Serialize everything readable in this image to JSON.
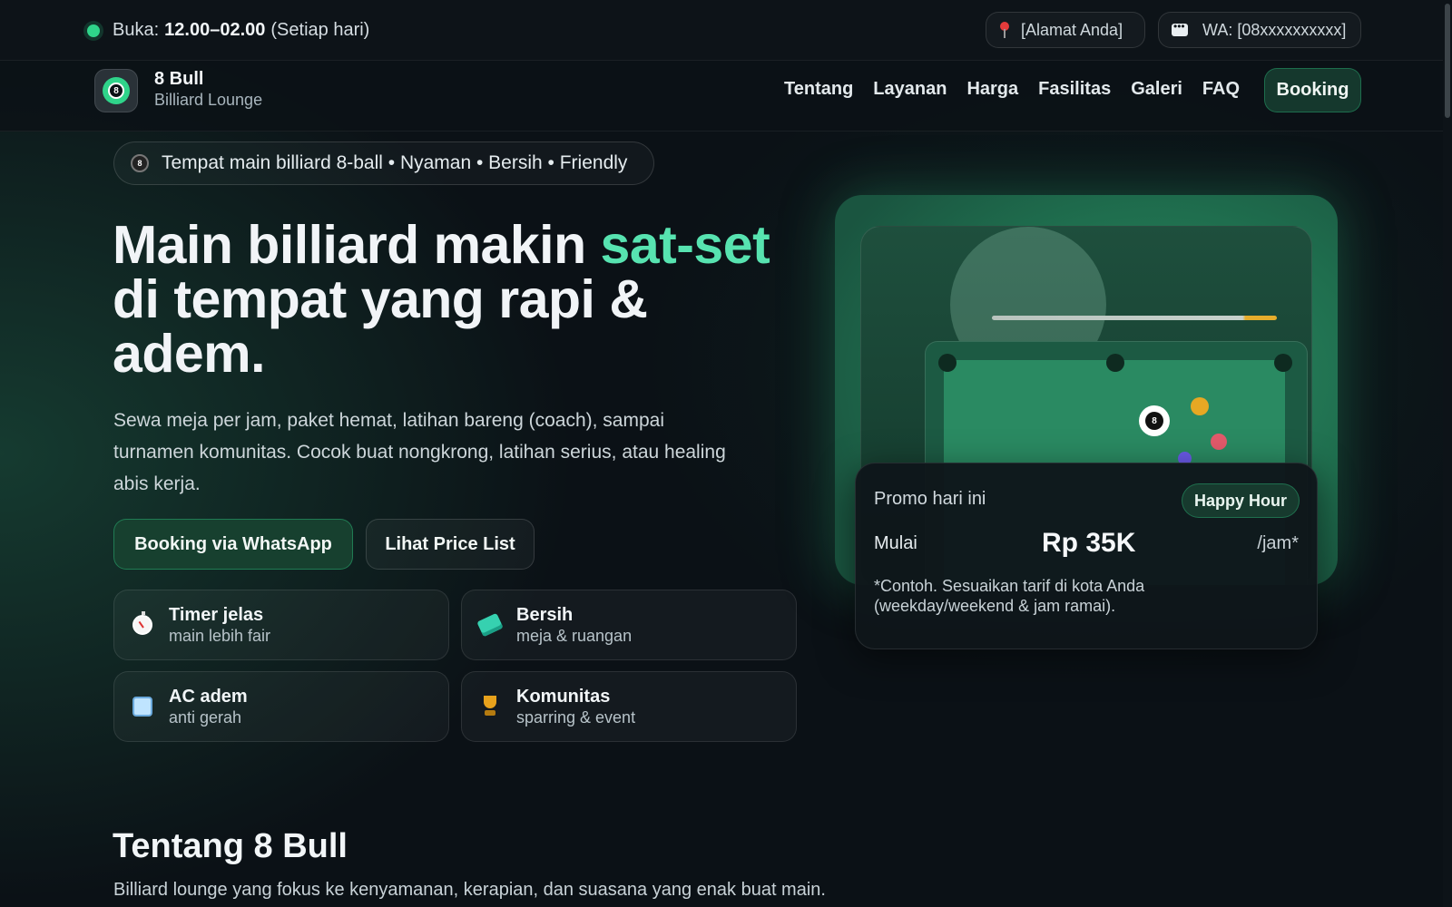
{
  "topbar": {
    "open_label": "Buka:",
    "open_hours": "12.00–02.00",
    "open_days": "(Setiap hari)",
    "address": "[Alamat Anda]",
    "whatsapp": "WA: [08xxxxxxxxxx]"
  },
  "nav": {
    "brand_name": "8 Bull",
    "brand_sub": "Billiard Lounge",
    "logo_number": "8",
    "links": [
      "Tentang",
      "Layanan",
      "Harga",
      "Fasilitas",
      "Galeri",
      "FAQ"
    ],
    "booking": "Booking"
  },
  "hero": {
    "tagline": "Tempat main billiard 8-ball • Nyaman • Bersih • Friendly",
    "tagline_icon_number": "8",
    "title_part1": "Main billiard makin ",
    "title_accent": "sat-set",
    "title_part2": "di tempat yang rapi & adem.",
    "description": "Sewa meja per jam, paket hemat, latihan bareng (coach), sampai turnamen komunitas. Cocok buat nongkrong, latihan serius, atau healing abis kerja.",
    "btn_primary": "Booking via WhatsApp",
    "btn_secondary": "Lihat Price List",
    "features": [
      {
        "title": "Timer jelas",
        "sub": "main lebih fair",
        "icon": "stopwatch-icon"
      },
      {
        "title": "Bersih",
        "sub": "meja & ruangan",
        "icon": "sponge-icon"
      },
      {
        "title": "AC adem",
        "sub": "anti gerah",
        "icon": "ice-cube-icon"
      },
      {
        "title": "Komunitas",
        "sub": "sparring & event",
        "icon": "trophy-icon"
      }
    ]
  },
  "visual": {
    "eight_ball_number": "8",
    "ball_colors": [
      "#e6a823",
      "#e35a6b",
      "#6a5ae8"
    ]
  },
  "promo": {
    "label": "Promo hari ini",
    "badge": "Happy Hour",
    "start": "Mulai",
    "price": "Rp 35K",
    "unit": "/jam*",
    "note": "*Contoh. Sesuaikan tarif di kota Anda (weekday/weekend & jam ramai)."
  },
  "about": {
    "title": "Tentang 8 Bull",
    "description": "Billiard lounge yang fokus ke kenyamanan, kerapian, dan suasana yang enak buat main."
  }
}
